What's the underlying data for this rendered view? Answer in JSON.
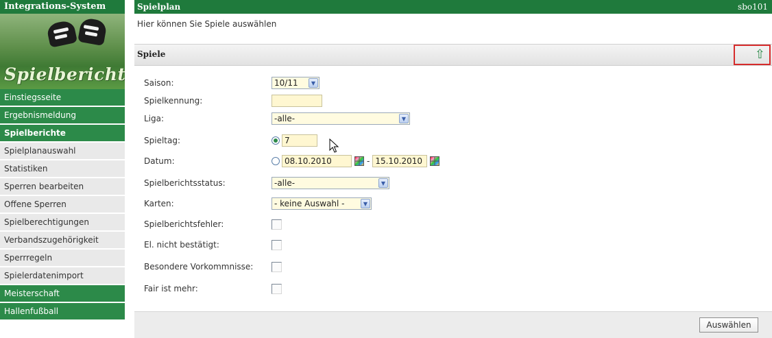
{
  "sidebar": {
    "brand": "Integrations-System",
    "logo": "Spielbericht",
    "items": [
      {
        "label": "Einstiegsseite",
        "style": "green"
      },
      {
        "label": "Ergebnismeldung",
        "style": "green"
      },
      {
        "label": "Spielberichte",
        "style": "green-bold"
      },
      {
        "label": "Spielplanauswahl",
        "style": "grey"
      },
      {
        "label": "Statistiken",
        "style": "grey"
      },
      {
        "label": "Sperren bearbeiten",
        "style": "grey"
      },
      {
        "label": "Offene Sperren",
        "style": "grey"
      },
      {
        "label": "Spielberechtigungen",
        "style": "grey"
      },
      {
        "label": "Verbandszugehörigkeit",
        "style": "grey"
      },
      {
        "label": "Sperrregeln",
        "style": "grey"
      },
      {
        "label": "Spielerdatenimport",
        "style": "grey"
      },
      {
        "label": "Meisterschaft",
        "style": "green"
      },
      {
        "label": "Hallenfußball",
        "style": "green"
      }
    ]
  },
  "header": {
    "title": "Spielplan",
    "user": "sbo101",
    "subtitle": "Hier können Sie Spiele auswählen"
  },
  "section": {
    "title": "Spiele",
    "up_icon": "up-arrow-icon"
  },
  "form": {
    "saison": {
      "label": "Saison:",
      "value": "10/11"
    },
    "spielkennung": {
      "label": "Spielkennung:",
      "value": ""
    },
    "liga": {
      "label": "Liga:",
      "value": "-alle-"
    },
    "spieltag": {
      "label": "Spieltag:",
      "value": "7",
      "selected": true
    },
    "datum": {
      "label": "Datum:",
      "from": "08.10.2010",
      "separator": "-",
      "to": "15.10.2010",
      "selected": false
    },
    "status": {
      "label": "Spielberichtsstatus:",
      "value": "-alle-"
    },
    "karten": {
      "label": "Karten:",
      "value": "- keine Auswahl -"
    },
    "fehler": {
      "label": "Spielberichtsfehler:",
      "checked": false
    },
    "nicht_bestaetigt": {
      "label": "El. nicht bestätigt:",
      "checked": false
    },
    "vorkommnisse": {
      "label": "Besondere Vorkommnisse:",
      "checked": false
    },
    "fair": {
      "label": "Fair ist mehr:",
      "checked": false
    }
  },
  "footer": {
    "submit_label": "Auswählen"
  },
  "colors": {
    "brand_green": "#1f7a3c",
    "nav_green": "#2c8a49",
    "highlight_red": "#d62b2b"
  }
}
